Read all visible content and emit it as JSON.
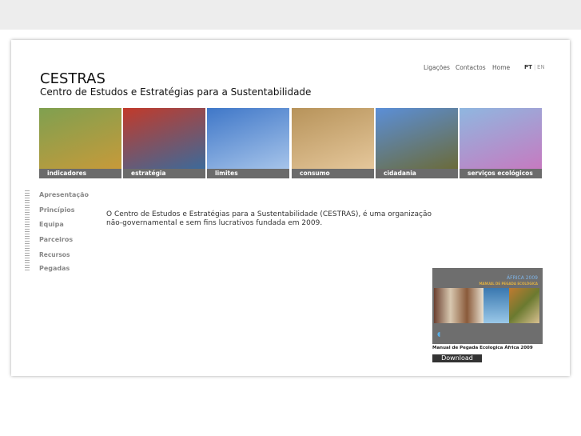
{
  "header": {
    "title": "CESTRAS",
    "subtitle": "Centro de Estudos  e Estratégias para a Sustentabilidade"
  },
  "topnav": [
    "Ligações",
    "Contactos",
    "Home"
  ],
  "lang": {
    "active": "PT",
    "other": "EN"
  },
  "tiles": [
    {
      "label": "indicadores",
      "colors": [
        "#7fa050",
        "#c79a3a"
      ]
    },
    {
      "label": "estratégia",
      "colors": [
        "#c23a2a",
        "#3c6a9a"
      ]
    },
    {
      "label": "limites",
      "colors": [
        "#3f77c8",
        "#a6c4ea"
      ]
    },
    {
      "label": "consumo",
      "colors": [
        "#b7935a",
        "#e5c79b"
      ]
    },
    {
      "label": "cidadania",
      "colors": [
        "#5b8fd8",
        "#6b6b3a"
      ]
    },
    {
      "label": "serviços ecológicos",
      "colors": [
        "#8fb7e0",
        "#c67ac0"
      ]
    }
  ],
  "sidebar": [
    "Apresentação",
    "Princípios",
    "Equipa",
    "Parceiros",
    "Recursos",
    "Pegadas"
  ],
  "intro": "O Centro de Estudos e Estratégias para a Sustentabilidade (CESTRAS), é uma organização não-governamental e sem fins lucrativos fundada em 2009.",
  "book": {
    "cover_title": "ÁFRICA 2009",
    "cover_subtitle": "MANUAL DE PEGADA ECOLÓGICA",
    "caption": "Manual de Pegada Ecologica África 2009",
    "download": "Download"
  }
}
